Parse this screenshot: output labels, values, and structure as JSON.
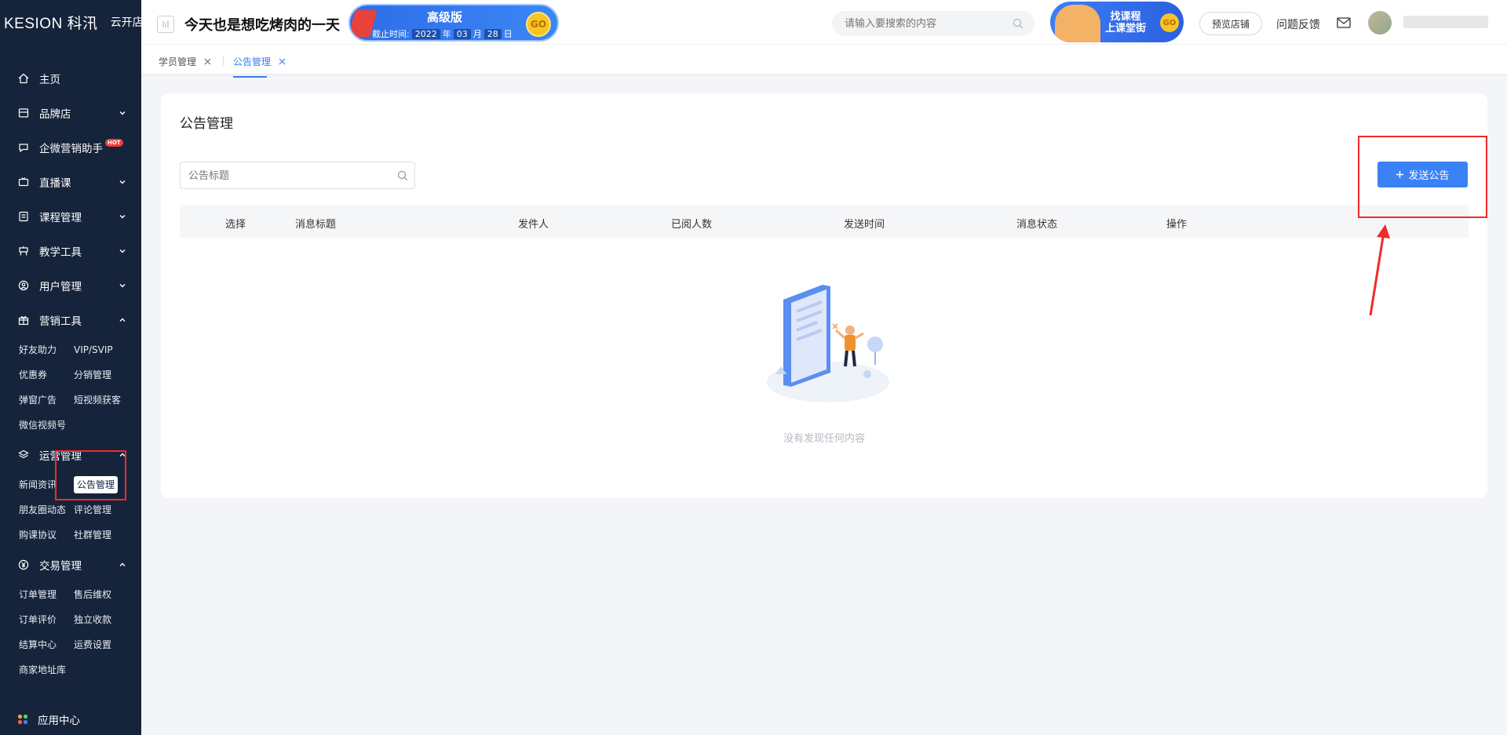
{
  "sidebar": {
    "logo": {
      "brand": "KESION 科汛",
      "store_type": "云开店"
    },
    "items": [
      {
        "label": "主页",
        "icon": "home-icon",
        "expandable": false
      },
      {
        "label": "品牌店",
        "icon": "shop-icon",
        "expandable": true,
        "expanded": false
      },
      {
        "label": "企微营销助手",
        "icon": "chat-icon",
        "expandable": false,
        "badge": "HOT"
      },
      {
        "label": "直播课",
        "icon": "live-icon",
        "expandable": true,
        "expanded": false
      },
      {
        "label": "课程管理",
        "icon": "course-icon",
        "expandable": true,
        "expanded": false
      },
      {
        "label": "教学工具",
        "icon": "teaching-icon",
        "expandable": true,
        "expanded": false
      },
      {
        "label": "用户管理",
        "icon": "user-icon",
        "expandable": true,
        "expanded": false
      },
      {
        "label": "营销工具",
        "icon": "gift-icon",
        "expandable": true,
        "expanded": true,
        "children": [
          "好友助力",
          "VIP/SVIP",
          "优惠券",
          "分销管理",
          "弹窗广告",
          "短视频获客",
          "微信视频号"
        ]
      },
      {
        "label": "运营管理",
        "icon": "layers-icon",
        "expandable": true,
        "expanded": true,
        "children": [
          "新闻资讯",
          "公告管理",
          "朋友圈动态",
          "评论管理",
          "购课协议",
          "社群管理"
        ],
        "active_child": "公告管理"
      },
      {
        "label": "交易管理",
        "icon": "yen-icon",
        "expandable": true,
        "expanded": true,
        "children": [
          "订单管理",
          "售后维权",
          "订单评价",
          "独立收款",
          "结算中心",
          "运费设置",
          "商家地址库"
        ]
      }
    ],
    "app_center": "应用中心"
  },
  "topbar": {
    "store_name": "今天也是想吃烤肉的一天",
    "banner": {
      "edition": "高级版",
      "expire_label": "截止时间:",
      "year": "2022",
      "year_unit": "年",
      "month": "03",
      "month_unit": "月",
      "day": "28",
      "day_unit": "日",
      "go": "GO"
    },
    "search_placeholder": "请输入要搜索的内容",
    "promo": {
      "line1": "找课程",
      "line2": "上课堂街",
      "go": "GO"
    },
    "preview_label": "预览店铺",
    "feedback_label": "问题反馈"
  },
  "tabs": [
    {
      "label": "学员管理",
      "active": false
    },
    {
      "label": "公告管理",
      "active": true
    }
  ],
  "main": {
    "title": "公告管理",
    "filter_placeholder": "公告标题",
    "send_button": "发送公告",
    "columns": [
      "选择",
      "消息标题",
      "发件人",
      "已阅人数",
      "发送时间",
      "消息状态",
      "操作"
    ],
    "rows": [],
    "empty_text": "没有发现任何内容"
  },
  "colors": {
    "sidebar_bg": "#15243b",
    "primary": "#3b82f6",
    "annotation": "#ef2b2b"
  }
}
